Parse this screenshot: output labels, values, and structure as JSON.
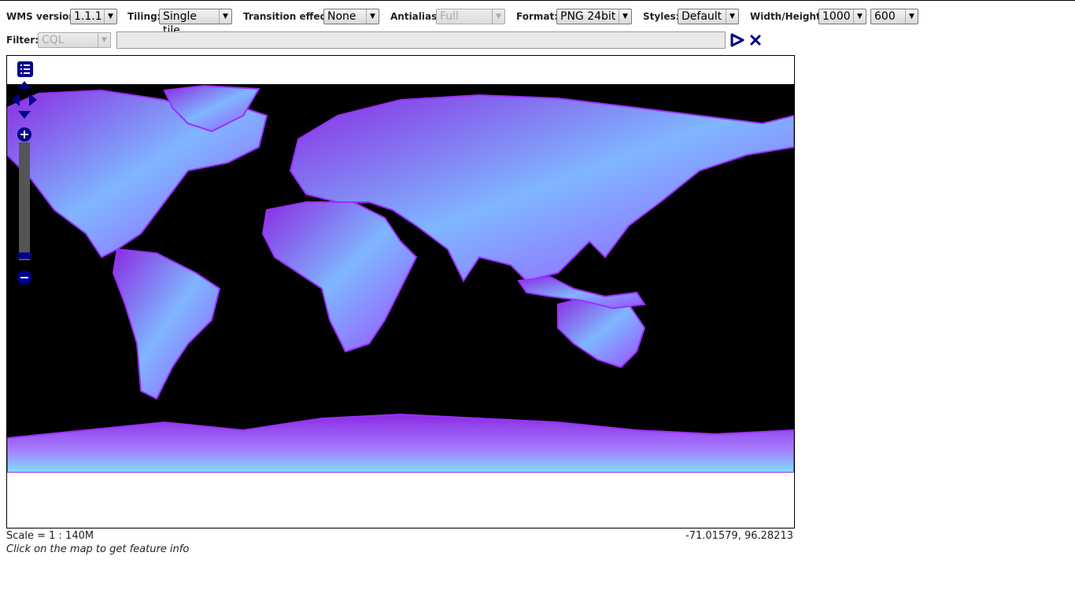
{
  "toolbar": {
    "wms_version": {
      "label": "WMS version:",
      "value": "1.1.1"
    },
    "tiling": {
      "label": "Tiling:",
      "value": "Single tile"
    },
    "transition": {
      "label": "Transition effect:",
      "value": "None"
    },
    "antialias": {
      "label": "Antialias:",
      "value": "Full"
    },
    "format": {
      "label": "Format:",
      "value": "PNG 24bit"
    },
    "styles": {
      "label": "Styles:",
      "value": "Default"
    },
    "size": {
      "label": "Width/Height:",
      "width": "1000",
      "height": "600"
    }
  },
  "filter": {
    "label": "Filter:",
    "type": "CQL",
    "value": ""
  },
  "status": {
    "scale": "Scale = 1 : 140M",
    "coords": "-71.01579, 96.28213",
    "info": "Click on the map to get feature info"
  },
  "colors": {
    "ocean": "#000000",
    "land_purple": "#8a2be2",
    "land_light": "#7fb6ff",
    "nav_blue": "#00008b"
  }
}
